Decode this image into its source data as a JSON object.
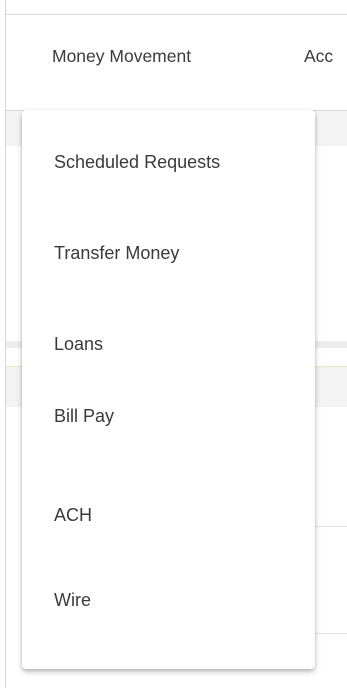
{
  "nav": {
    "items": [
      {
        "label": "Money Movement"
      },
      {
        "label": "Acc"
      }
    ]
  },
  "dropdown": {
    "items": [
      {
        "label": "Scheduled Requests"
      },
      {
        "label": "Transfer Money"
      },
      {
        "label": "Loans"
      },
      {
        "label": "Bill Pay"
      },
      {
        "label": "ACH"
      },
      {
        "label": "Wire"
      }
    ]
  },
  "colors": {
    "text": "#3a3a3a",
    "menu_bg": "#ffffff",
    "page_band": "#f4f4f4"
  }
}
